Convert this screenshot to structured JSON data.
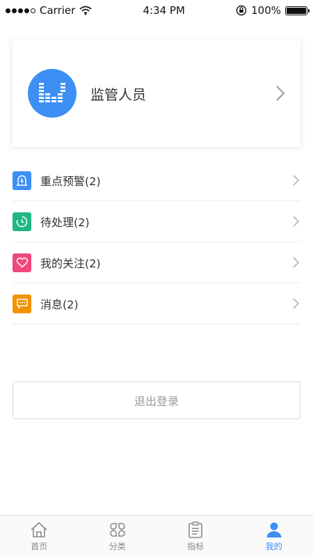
{
  "status_bar": {
    "carrier": "Carrier",
    "time": "4:34 PM",
    "battery": "100%"
  },
  "profile": {
    "name": "监管人员",
    "avatar_color": "#3d8ff3"
  },
  "menu": {
    "items": [
      {
        "label": "重点预警(2)",
        "icon": "alarm-bell-icon",
        "color": "#3d8ff3"
      },
      {
        "label": "待处理(2)",
        "icon": "clock-icon",
        "color": "#22b585"
      },
      {
        "label": "我的关注(2)",
        "icon": "heart-icon",
        "color": "#f0487a"
      },
      {
        "label": "消息(2)",
        "icon": "message-icon",
        "color": "#f29200"
      }
    ]
  },
  "logout_label": "退出登录",
  "tabs": [
    {
      "label": "首页",
      "icon": "home-icon",
      "active": false
    },
    {
      "label": "分类",
      "icon": "category-icon",
      "active": false
    },
    {
      "label": "指标",
      "icon": "clipboard-icon",
      "active": false
    },
    {
      "label": "我的",
      "icon": "person-icon",
      "active": true
    }
  ],
  "colors": {
    "accent": "#3d8ff3",
    "inactive_tab": "#888888"
  }
}
